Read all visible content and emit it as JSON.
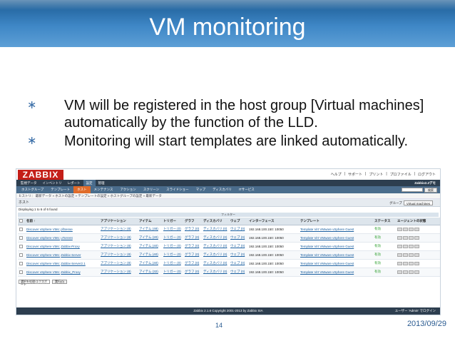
{
  "slide": {
    "title": "VM monitoring",
    "bullets": [
      "VM will be registered in the host group [Virtual machines] automatically by the function of the LLD.",
      "Monitoring will start templates are linked automatically."
    ],
    "bullet_mark": "∗",
    "page_number": "14",
    "date": "2013/09/29",
    "header_color": "#3f87c6",
    "accent_color": "#2a5b91"
  },
  "zabbix": {
    "logo": "ZABBIX",
    "top_links": [
      "ヘルプ",
      "|",
      "サポート",
      "|",
      "プリント",
      "|",
      "プロファイル",
      "|",
      "ログアウト"
    ],
    "main_menu": [
      "監視データ",
      "インベントリ",
      "レポート",
      "設定",
      "管理"
    ],
    "main_menu_active": 3,
    "server_name": "Zabbix2.2デモ",
    "sub_menu": [
      "ホストグループ",
      "テンプレート",
      "ホスト",
      "メンテナンス",
      "アクション",
      "スクリーン",
      "スライドショー",
      "マップ",
      "ディスカバリ",
      "ITサービス"
    ],
    "sub_menu_active": 2,
    "search_button": "検索",
    "breadcrumb": "ヒストリ： 最新データ » ホストの設定 » テンプレートの設定 » ホストグループの設定 » 最新データ",
    "section_title": "ホスト",
    "group_label": "グループ",
    "group_value": "Virtual machines",
    "displaying": "Displaying 1 to 6 of 6 found",
    "filter_label": "フィルター",
    "columns": [
      "",
      "名前 ↑",
      "アプリケーション",
      "アイテム",
      "トリガー",
      "グラフ",
      "ディスカバリ",
      "ウェブ",
      "インターフェース",
      "テンプレート",
      "ステータス",
      "エージェントの状態"
    ],
    "rows": [
      {
        "name_prefix": "Discover vSphere VMs:",
        "name": "pfSense",
        "apps": "アプリケーション (8)",
        "items": "アイテム (48)",
        "triggers": "トリガー (0)",
        "graphs": "グラフ (0)",
        "discovery": "ディスカバリ (0)",
        "web": "ウェブ (0)",
        "interface": "192.168.100.150: 10050",
        "template": "Template Virt VMware vSphere Guest",
        "status": "有効"
      },
      {
        "name_prefix": "Discover vSphere VMs:",
        "name": "uTorrent",
        "apps": "アプリケーション (8)",
        "items": "アイテム (20)",
        "triggers": "トリガー (0)",
        "graphs": "グラフ (0)",
        "discovery": "ディスカバリ (0)",
        "web": "ウェブ (0)",
        "interface": "192.168.100.150: 10050",
        "template": "Template Virt VMware vSphere Guest",
        "status": "有効"
      },
      {
        "name_prefix": "Discover vSphere VMs:",
        "name": "Zabbix-Proxy",
        "apps": "アプリケーション (8)",
        "items": "アイテム (40)",
        "triggers": "トリガー (0)",
        "graphs": "グラフ (0)",
        "discovery": "ディスカバリ (0)",
        "web": "ウェブ (0)",
        "interface": "192.168.100.150: 10050",
        "template": "Template Virt VMware vSphere Guest",
        "status": "有効"
      },
      {
        "name_prefix": "Discover vSphere VMs:",
        "name": "Zabbix-Server",
        "apps": "アプリケーション (8)",
        "items": "アイテム (40)",
        "triggers": "トリガー (0)",
        "graphs": "グラフ (0)",
        "discovery": "ディスカバリ (0)",
        "web": "ウェブ (0)",
        "interface": "192.168.100.150: 10050",
        "template": "Template Virt VMware vSphere Guest",
        "status": "有効"
      },
      {
        "name_prefix": "Discover vSphere VMs:",
        "name": "Zabbix-Server2.1",
        "apps": "アプリケーション (8)",
        "items": "アイテム (40)",
        "triggers": "トリガー (0)",
        "graphs": "グラフ (0)",
        "discovery": "ディスカバリ (0)",
        "web": "ウェブ (0)",
        "interface": "192.168.100.150: 10050",
        "template": "Template Virt VMware vSphere Guest",
        "status": "有効"
      },
      {
        "name_prefix": "Discover vSphere VMs:",
        "name": "Zabbix_Proxy",
        "apps": "アプリケーション (8)",
        "items": "アイテム (32)",
        "triggers": "トリガー (0)",
        "graphs": "グラフ (0)",
        "discovery": "ディスカバリ (0)",
        "web": "ウェブ (0)",
        "interface": "192.168.100.150: 10050",
        "template": "Template Virt VMware vSphere Guest",
        "status": "有効"
      }
    ],
    "action_select": "選択を処理/エクスポート",
    "action_button": "実行(0)",
    "footer_copyright": "Zabbix 2.1.6 Copyright 2001-2013 by Zabbix SIA",
    "footer_user": "ユーザー 'Admin' でログイン"
  }
}
